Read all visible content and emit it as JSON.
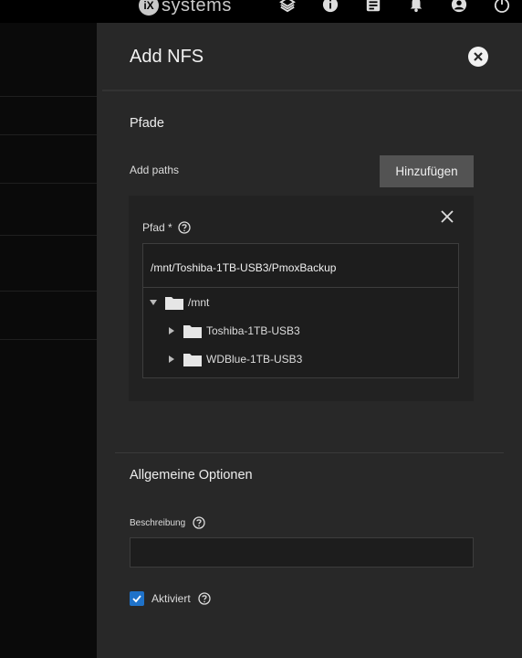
{
  "topbar": {
    "logo_mark": "iX",
    "logo_text": "systems",
    "icons": [
      "truecommand-icon",
      "info-icon",
      "tasks-icon",
      "bell-icon",
      "account-icon",
      "power-icon"
    ]
  },
  "panel": {
    "title": "Add NFS",
    "paths_section": {
      "title": "Pfade",
      "add_label": "Add paths",
      "add_button": "Hinzufügen",
      "path_label": "Pfad *",
      "path_value": "/mnt/Toshiba-1TB-USB3/PmoxBackup",
      "tree": {
        "root": "/mnt",
        "children": [
          "Toshiba-1TB-USB3",
          "WDBlue-1TB-USB3"
        ]
      }
    },
    "general_section": {
      "title": "Allgemeine Optionen",
      "description_label": "Beschreibung",
      "description_value": "",
      "enabled_label": "Aktiviert",
      "enabled_checked": true
    }
  },
  "colors": {
    "accent": "#1f72c9",
    "panel_bg": "#282828",
    "card_bg": "#222222"
  }
}
